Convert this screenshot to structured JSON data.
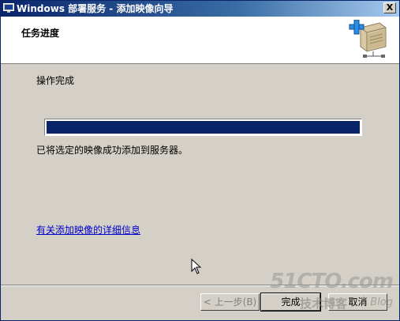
{
  "window": {
    "title": "Windows 部署服务 - 添加映像向导",
    "close_label": "X"
  },
  "header": {
    "title": "任务进度",
    "icon": "add-image-server-icon"
  },
  "content": {
    "status": "操作完成",
    "progress_percent": 100,
    "result": "已将选定的映像成功添加到服务器。",
    "details_link": "有关添加映像的详细信息"
  },
  "buttons": {
    "back": "< 上一步(B)",
    "finish": "完成",
    "cancel": "取消"
  },
  "watermark": {
    "brand": "51CTO.com",
    "subtitle": "技术博客",
    "blog": "Blog"
  },
  "colors": {
    "progress_fill": "#0a246a",
    "titlebar": "#0a246a",
    "link": "#0000cc"
  }
}
